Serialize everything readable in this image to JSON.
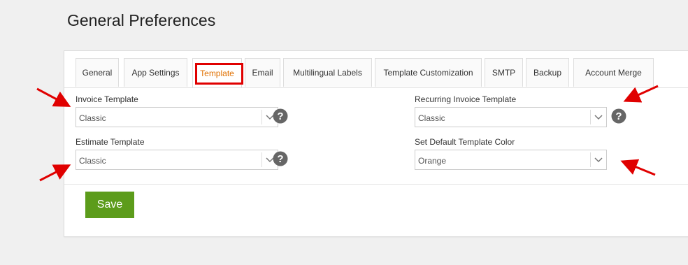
{
  "page": {
    "title": "General Preferences"
  },
  "tabs": [
    "General",
    "App Settings",
    "Template",
    "Email",
    "Multilingual Labels",
    "Template Customization",
    "SMTP",
    "Backup",
    "Account Merge"
  ],
  "active_tab": "Template",
  "fields": {
    "invoice_template": {
      "label": "Invoice Template",
      "value": "Classic"
    },
    "estimate_template": {
      "label": "Estimate Template",
      "value": "Classic"
    },
    "recurring_invoice_template": {
      "label": "Recurring Invoice Template",
      "value": "Classic"
    },
    "default_template_color": {
      "label": "Set Default Template Color",
      "value": "Orange"
    }
  },
  "actions": {
    "save": "Save"
  },
  "colors": {
    "accent": "#e07000",
    "save": "#5c9c1b",
    "annotation": "#e00000"
  },
  "icons": {
    "help": "help-circle-icon",
    "dropdown": "chevron-down-icon",
    "annotation": "red-arrow-icon"
  }
}
